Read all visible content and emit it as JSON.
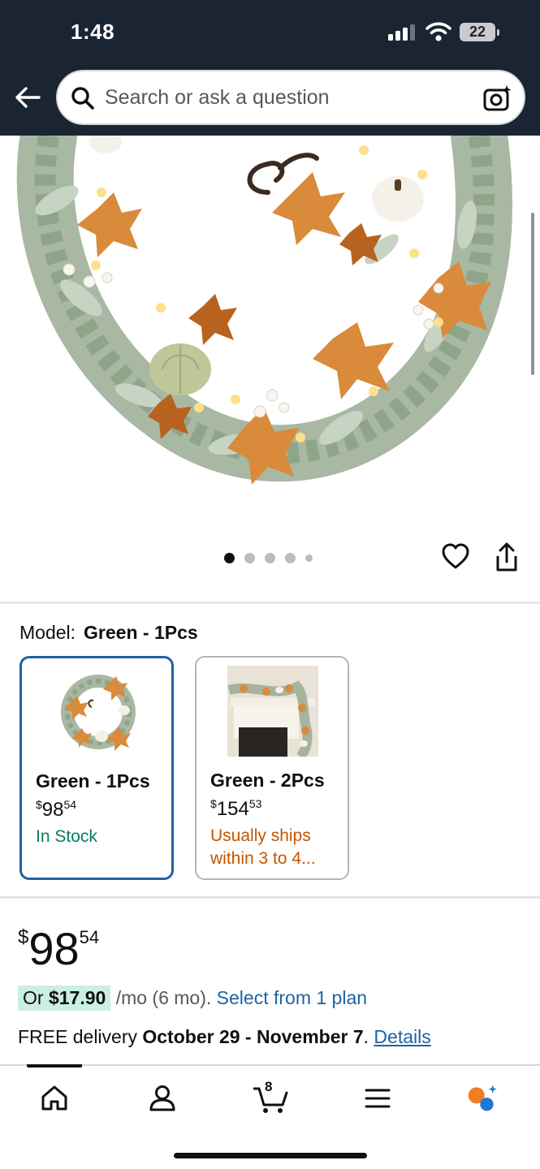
{
  "status_bar": {
    "time": "1:48",
    "battery": "22"
  },
  "search": {
    "placeholder": "Search or ask a question"
  },
  "gallery": {
    "dot_count": 5,
    "active_index": 0
  },
  "model": {
    "label": "Model:",
    "selected": "Green - 1Pcs",
    "options": [
      {
        "name": "Green - 1Pcs",
        "price_symbol": "$",
        "price_whole": "98",
        "price_fraction": "54",
        "status": "In Stock"
      },
      {
        "name": "Green - 2Pcs",
        "price_symbol": "$",
        "price_whole": "154",
        "price_fraction": "53",
        "status": "Usually ships within 3 to 4..."
      }
    ]
  },
  "price": {
    "symbol": "$",
    "whole": "98",
    "fraction": "54",
    "monthly_prefix": "Or ",
    "monthly_amount": "$17.90",
    "monthly_suffix": " /mo (6 mo). ",
    "plan_link": "Select from 1 plan"
  },
  "delivery": {
    "prefix": "FREE delivery ",
    "dates": "October 29 - November 7",
    "suffix": ". ",
    "details_link": "Details"
  },
  "bottom_nav": {
    "cart_count": "8",
    "items": [
      "home-icon",
      "account-icon",
      "cart-icon",
      "menu-icon",
      "rufus-icon"
    ]
  },
  "colors": {
    "header_bg": "#1b2433",
    "link": "#2162a1",
    "in_stock": "#067d62",
    "ships_later": "#c45500",
    "selected_border": "#2162a1",
    "monthly_highlight": "#cbeee5"
  }
}
